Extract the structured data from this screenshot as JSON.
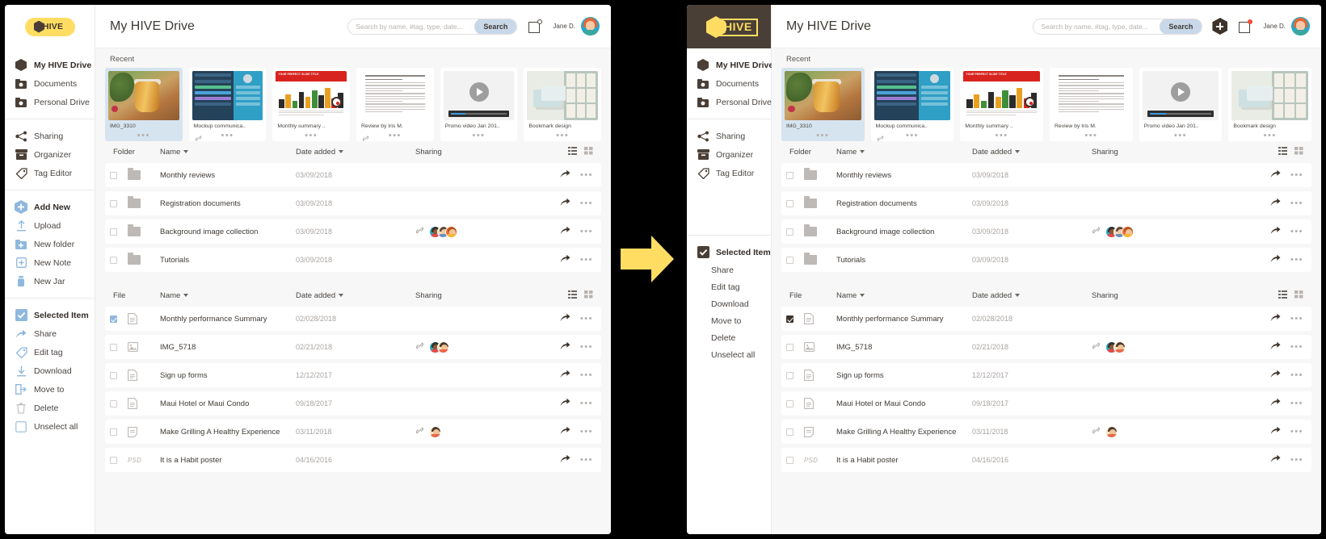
{
  "brand": {
    "name": "HIVE",
    "logo_icon": "hexagon-icon",
    "yellow": "#ffdd63",
    "dark": "#4a3f36"
  },
  "panels": [
    {
      "id": "before",
      "variant": "light-logo"
    },
    {
      "id": "after",
      "variant": "dark-logo"
    }
  ],
  "sidebar": {
    "drives": [
      {
        "label": "My HIVE Drive",
        "icon": "hexagon-icon",
        "active": true
      },
      {
        "label": "Documents",
        "icon": "documents-folder-icon",
        "active": false
      },
      {
        "label": "Personal Drive",
        "icon": "personal-drive-icon",
        "active": false
      }
    ],
    "tools": [
      {
        "label": "Sharing",
        "icon": "share-network-icon"
      },
      {
        "label": "Organizer",
        "icon": "organizer-box-icon"
      },
      {
        "label": "Tag Editor",
        "icon": "tag-icon"
      }
    ],
    "add_new": {
      "label": "Add New",
      "icon": "plus-hexagon-icon"
    },
    "add_items": [
      {
        "label": "Upload",
        "icon": "upload-icon"
      },
      {
        "label": "New folder",
        "icon": "new-folder-icon"
      },
      {
        "label": "New Note",
        "icon": "new-note-icon"
      },
      {
        "label": "New Jar",
        "icon": "new-jar-icon"
      }
    ],
    "selected": {
      "label": "Selected Item",
      "icon": "checkbox-checked-icon"
    },
    "selected_items": [
      {
        "label": "Share",
        "icon": "share-arrow-icon"
      },
      {
        "label": "Edit tag",
        "icon": "tag-icon"
      },
      {
        "label": "Download",
        "icon": "download-icon"
      },
      {
        "label": "Move to",
        "icon": "move-to-icon"
      },
      {
        "label": "Delete",
        "icon": "trash-icon"
      },
      {
        "label": "Unselect all",
        "icon": "checkbox-empty-icon"
      }
    ]
  },
  "header": {
    "title": "My HIVE Drive",
    "search": {
      "placeholder": "Search by name, #tag, type, date...",
      "value": "",
      "button_label": "Search"
    },
    "add_button_icon": "plus-hexagon-icon",
    "notification_icon": "notification-square-icon",
    "user_name": "Jane D.",
    "avatar_icon": "user-avatar"
  },
  "recent": {
    "label": "Recent",
    "cards": [
      {
        "name": "IMG_3310",
        "thumb": "photo-honey-jar",
        "shared_link": false,
        "selected": true
      },
      {
        "name": "Mockup communica..",
        "thumb": "ui-mockup",
        "shared_link": true,
        "selected": false
      },
      {
        "name": "Monthly summary ..",
        "thumb": "chart-slide",
        "shared_link": false,
        "selected": false
      },
      {
        "name": "Review by Iris M.",
        "thumb": "text-document",
        "shared_link": true,
        "selected": false
      },
      {
        "name": "Promo video Jan 201..",
        "thumb": "video-player",
        "shared_link": false,
        "selected": false
      },
      {
        "name": "Bookmark design",
        "thumb": "bookmark-design",
        "shared_link": false,
        "selected": false
      }
    ],
    "menu_icon": "more-dots-icon",
    "link_icon": "link-chain-icon"
  },
  "folder_table": {
    "columns": {
      "type": "Folder",
      "name": "Name",
      "date": "Date added",
      "sharing": "Sharing"
    },
    "view_list_icon": "list-view-icon",
    "view_grid_icon": "grid-view-icon",
    "rows": [
      {
        "name": "Monthly reviews",
        "date": "03/09/2018",
        "checked": false,
        "link": false,
        "avatars": []
      },
      {
        "name": "Registration documents",
        "date": "03/09/2018",
        "checked": false,
        "link": false,
        "avatars": []
      },
      {
        "name": "Background image collection",
        "date": "03/09/2018",
        "checked": false,
        "link": true,
        "avatars": [
          "av-a",
          "av-b",
          "av-c"
        ]
      },
      {
        "name": "Tutorials",
        "date": "03/09/2018",
        "checked": false,
        "link": false,
        "avatars": []
      }
    ]
  },
  "file_table": {
    "columns": {
      "type": "File",
      "name": "Name",
      "date": "Date added",
      "sharing": "Sharing"
    },
    "view_list_icon": "list-view-icon",
    "view_grid_icon": "grid-view-icon",
    "rows": [
      {
        "name": "Monthly performance Summary",
        "date": "02/028/2018",
        "checked": true,
        "link": false,
        "avatars": [],
        "kind": "doc"
      },
      {
        "name": "IMG_5718",
        "date": "02/21/2018",
        "checked": false,
        "link": true,
        "avatars": [
          "av-a",
          "av-d"
        ],
        "kind": "image"
      },
      {
        "name": "Sign up forms",
        "date": "12/12/2017",
        "checked": false,
        "link": false,
        "avatars": [],
        "kind": "doc"
      },
      {
        "name": "Maui Hotel or Maui Condo",
        "date": "09/18/2017",
        "checked": false,
        "link": false,
        "avatars": [],
        "kind": "doc"
      },
      {
        "name": "Make Grilling A Healthy Experience",
        "date": "03/11/2018",
        "checked": false,
        "link": true,
        "avatars": [
          "av-d"
        ],
        "kind": "note"
      },
      {
        "name": "It is a Habit poster",
        "date": "04/16/2016",
        "checked": false,
        "link": false,
        "avatars": [],
        "kind": "psd",
        "type_label": "PSD"
      }
    ],
    "share_icon": "share-arrow-icon",
    "more_icon": "more-dots-icon"
  },
  "transition": {
    "icon": "right-arrow-icon",
    "color": "#ffdd63"
  }
}
